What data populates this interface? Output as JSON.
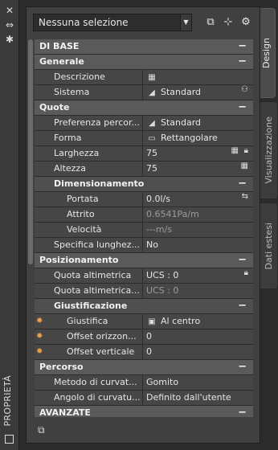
{
  "palette": {
    "title": "PROPRIETÀ"
  },
  "selector": {
    "value": "Nessuna selezione"
  },
  "tabs": [
    {
      "label": "Design",
      "active": true
    },
    {
      "label": "Visualizzazione",
      "active": false
    },
    {
      "label": "Dati estesi",
      "active": false
    }
  ],
  "sections": {
    "base": {
      "label": "DI BASE"
    },
    "generale": {
      "label": "Generale",
      "descrizione": {
        "label": "Descrizione",
        "value": ""
      },
      "sistema": {
        "label": "Sistema",
        "value": "Standard"
      }
    },
    "quote": {
      "label": "Quote",
      "preferenza": {
        "label": "Preferenza percor...",
        "value": "Standard"
      },
      "forma": {
        "label": "Forma",
        "value": "Rettangolare"
      },
      "larghezza": {
        "label": "Larghezza",
        "value": "75"
      },
      "altezza": {
        "label": "Altezza",
        "value": "75"
      },
      "dimensionamento": {
        "label": "Dimensionamento",
        "portata": {
          "label": "Portata",
          "value": "0.0l/s"
        },
        "attrito": {
          "label": "Attrito",
          "value": "0.6541Pa/m"
        },
        "velocita": {
          "label": "Velocità",
          "value": "---m/s"
        }
      },
      "specifica": {
        "label": "Specifica lunghez...",
        "value": "No"
      }
    },
    "posizionamento": {
      "label": "Posizionamento",
      "quota1": {
        "label": "Quota altimetrica",
        "value": "UCS : 0"
      },
      "quota2": {
        "label": "Quota  altimetrica...",
        "value": "UCS : 0"
      },
      "giustificazione": {
        "label": "Giustificazione",
        "giustifica": {
          "label": "Giustifica",
          "value": "Al centro"
        },
        "offset_orizz": {
          "label": "Offset orizzon...",
          "value": "0"
        },
        "offset_vert": {
          "label": "Offset verticale",
          "value": "0"
        }
      }
    },
    "percorso": {
      "label": "Percorso",
      "metodo": {
        "label": "Metodo di curvat...",
        "value": "Gomito"
      },
      "angolo": {
        "label": "Angolo di curvatu...",
        "value": "Definito dall'utente"
      }
    },
    "avanzate": {
      "label": "AVANZATE"
    }
  }
}
